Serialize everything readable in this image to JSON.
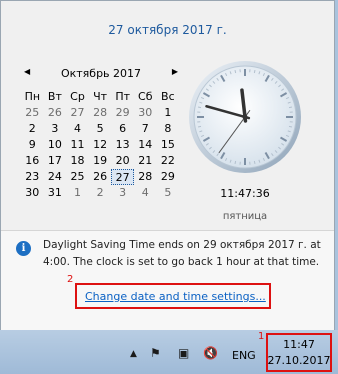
{
  "flyout": {
    "top_date": "27 октября 2017 г.",
    "calendar": {
      "month_year": "Октябрь 2017",
      "prev_icon": "◀",
      "next_icon": "▶",
      "weekdays": [
        "Пн",
        "Вт",
        "Ср",
        "Чт",
        "Пт",
        "Сб",
        "Вс"
      ],
      "weeks": [
        [
          "25",
          "26",
          "27",
          "28",
          "29",
          "30",
          "1"
        ],
        [
          "2",
          "3",
          "4",
          "5",
          "6",
          "7",
          "8"
        ],
        [
          "9",
          "10",
          "11",
          "12",
          "13",
          "14",
          "15"
        ],
        [
          "16",
          "17",
          "18",
          "19",
          "20",
          "21",
          "22"
        ],
        [
          "23",
          "24",
          "25",
          "26",
          "27",
          "28",
          "29"
        ],
        [
          "30",
          "31",
          "1",
          "2",
          "3",
          "4",
          "5"
        ]
      ],
      "today": "27"
    },
    "clock": {
      "time": "11:47:36",
      "weekday": "пятница",
      "hour": 11,
      "minute": 47,
      "second": 36
    },
    "info": {
      "icon": "i",
      "text": "Daylight Saving Time ends on 29 октября 2017 г. at 4:00. The clock is set to go back 1 hour at that time."
    },
    "link": "Change date and time settings...",
    "badge_2": "2"
  },
  "taskbar": {
    "badge_1": "1",
    "tray_icons": [
      "▲",
      "⚑",
      "▣",
      "🔇"
    ],
    "language": "ENG",
    "time": "11:47",
    "date": "27.10.2017"
  },
  "colors": {
    "accent_blue": "#1e5a9e",
    "link_blue": "#0b61c4",
    "highlight_red": "#dd1111",
    "taskbar": "#a9c3dd"
  }
}
